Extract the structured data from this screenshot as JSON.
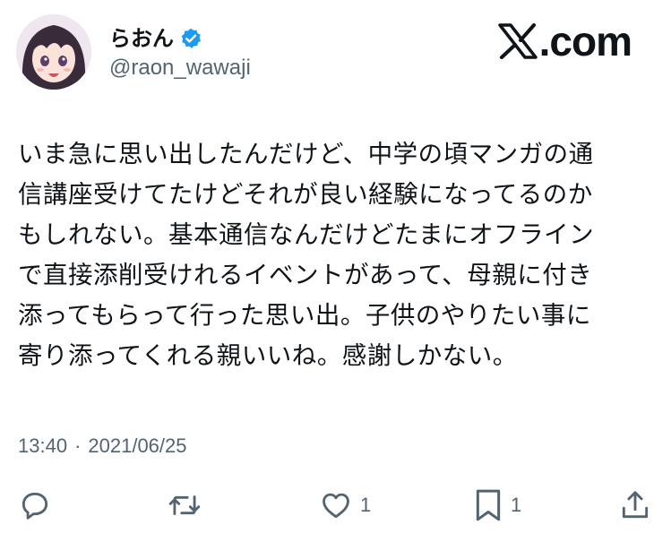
{
  "user": {
    "display_name": "らおん",
    "handle": "@raon_wawaji",
    "verified": true,
    "verified_color": "#1d9bf0"
  },
  "brand": {
    "text": ".com",
    "icon": "x-logo-icon"
  },
  "tweet": {
    "lines": [
      "いま急に思い出したんだけど、中学の頃マンガの通",
      "信講座受けてたけどそれが良い経験になってるのか",
      "もしれない。基本通信なんだけどたまにオフライン",
      "で直接添削受けれるイベントがあって、母親に付き",
      "添ってもらって行った思い出。子供のやりたい事に",
      "寄り添ってくれる親いいね。感謝しかない。"
    ],
    "time": "13:40",
    "separator": "·",
    "date": "2021/06/25"
  },
  "actions": {
    "reply": {
      "icon": "reply-icon"
    },
    "retweet": {
      "icon": "retweet-icon"
    },
    "like": {
      "icon": "heart-icon",
      "count": "1"
    },
    "bookmark": {
      "icon": "bookmark-icon",
      "count": "1"
    },
    "share": {
      "icon": "share-icon"
    }
  },
  "colors": {
    "text": "#0f1419",
    "secondary": "#536471",
    "verified": "#1d9bf0"
  }
}
